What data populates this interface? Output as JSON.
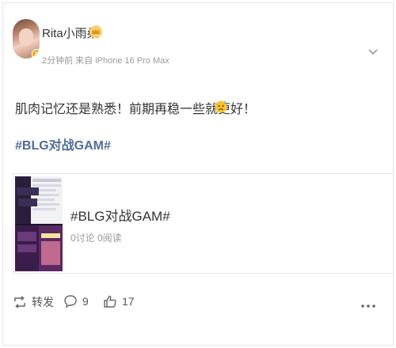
{
  "post": {
    "user_name": "Rita小雨桑",
    "meta": "2分钟前 来自 iPhone 16 Pro Max",
    "text": "肌肉记忆还是熟悉！前期再稳一些就更好！",
    "hashtag": "#BLG对战GAM#",
    "badge": "V"
  },
  "card": {
    "title": "#BLG对战GAM#",
    "stats": "0讨论 0阅读"
  },
  "actions": {
    "repost_label": "转发",
    "comment_count": "9",
    "like_count": "17"
  },
  "icons": [
    "crown-icon",
    "chevron-down-icon",
    "sweat-emoji-icon",
    "repost-icon",
    "comment-icon",
    "like-icon",
    "more-icon"
  ],
  "colors": {
    "hashtag": "#4e6e9a",
    "meta": "#999999",
    "text": "#333333"
  }
}
